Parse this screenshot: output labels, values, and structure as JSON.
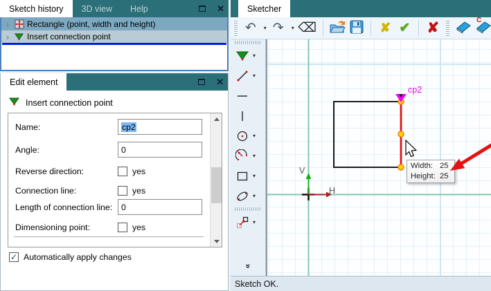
{
  "icons": {
    "dropdown": "▾",
    "close": "✕",
    "expander": "›",
    "undo": "↶",
    "redo": "↷",
    "backspace": "⌫",
    "cancel_yellow": "✘",
    "confirm_check": "✔",
    "delete_red": "✘",
    "checkmark": "✓",
    "more_tools": "»",
    "eraser_c_letter": "C"
  },
  "sketch_history_panel": {
    "tabs": [
      {
        "label": "Sketch history",
        "active": true
      },
      {
        "label": "3D view",
        "active": false
      },
      {
        "label": "Help",
        "active": false
      }
    ],
    "items": [
      {
        "label": "Rectangle (point, width and height)",
        "icon": "rectangle-move-icon"
      },
      {
        "label": "Insert connection point",
        "icon": "green-triangle-icon"
      }
    ]
  },
  "edit_element_panel": {
    "tab_label": "Edit element",
    "header": "Insert connection point",
    "fields": [
      {
        "label": "Name:",
        "type": "text",
        "value": "cp2",
        "selected": true
      },
      {
        "label": "Angle:",
        "type": "text",
        "value": "0"
      },
      {
        "label": "Reverse direction:",
        "type": "checkbox",
        "checked": false,
        "suffix": "yes"
      },
      {
        "label": "Connection line:",
        "type": "checkbox",
        "checked": false,
        "suffix": "yes"
      },
      {
        "label": "Length of connection line:",
        "type": "text",
        "value": "0"
      },
      {
        "label": "Dimensioning point:",
        "type": "checkbox",
        "checked": false,
        "suffix": "yes"
      }
    ],
    "auto_apply": {
      "label": "Automatically apply changes",
      "checked": true
    }
  },
  "sketcher_panel": {
    "tab_label": "Sketcher",
    "status_text": "Sketch OK.",
    "canvas": {
      "connection_point_label": "cp2",
      "v_axis_label": "V",
      "h_axis_label": "H",
      "tooltip": {
        "width_label": "Width:",
        "width_value": "25",
        "height_label": "Height:",
        "height_value": "25"
      }
    }
  },
  "colors": {
    "tab_teal": "#2b6f79",
    "tree_selection": "#7da8bf",
    "tree_hover": "#b9cbd4",
    "insertion_line_blue": "#0020dd",
    "axis_teal": "#86c9ad",
    "sketch_red": "#e51212",
    "magenta": "#f403f4",
    "handle_yellow": "#ffd400",
    "handle_orange": "#f08000"
  }
}
